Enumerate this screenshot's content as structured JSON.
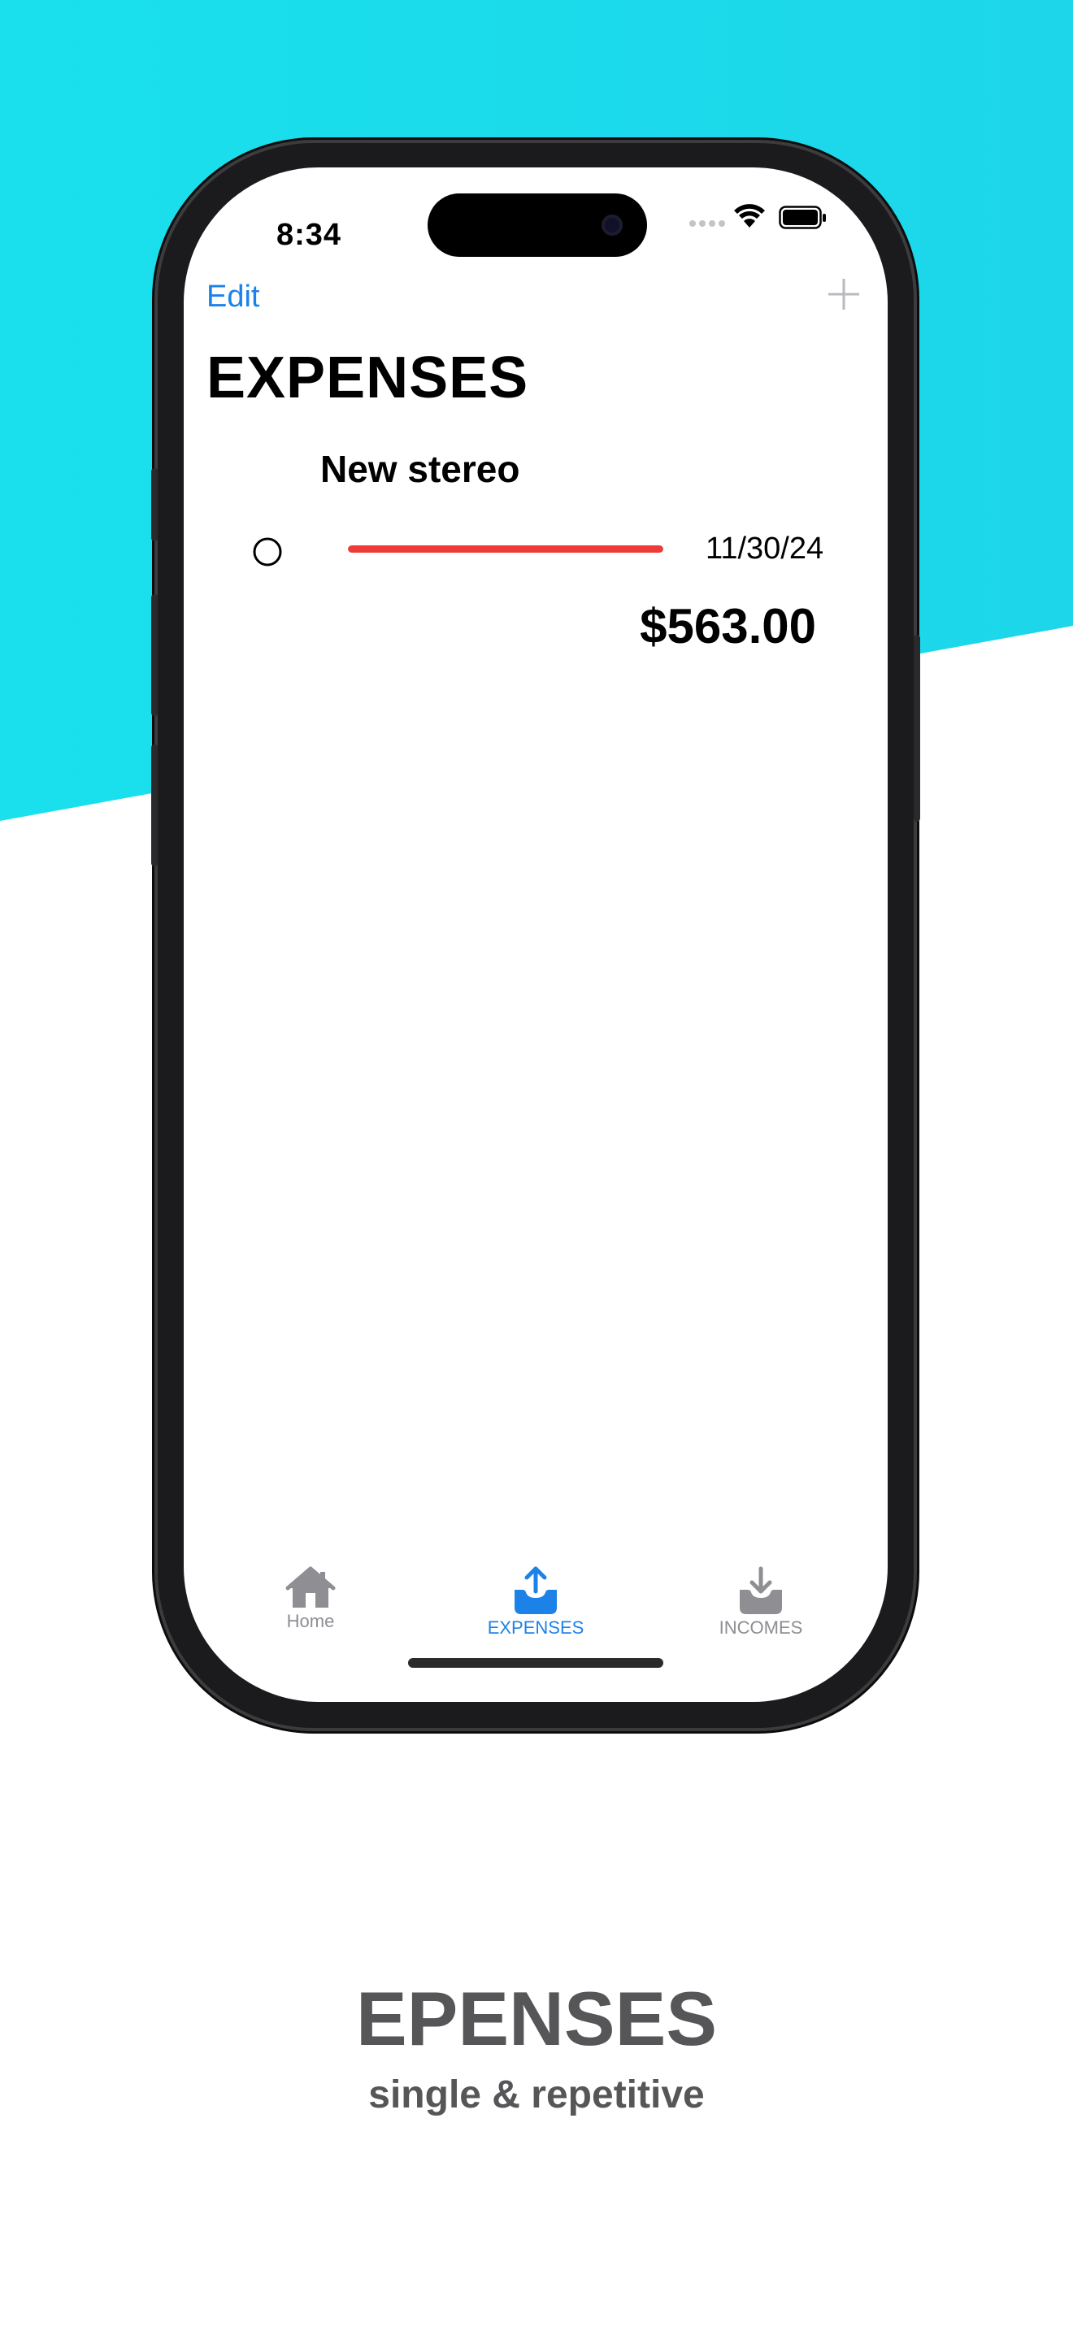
{
  "colors": {
    "background_accent": "#1cdbea",
    "link_blue": "#1d82e8",
    "progress_red": "#ee3b37",
    "tab_inactive": "#8e8e93",
    "caption_gray": "#565658"
  },
  "status_bar": {
    "time": "8:34",
    "icons": [
      "cellular-signal-icon",
      "wifi-icon",
      "battery-icon"
    ]
  },
  "nav": {
    "edit_label": "Edit",
    "add_icon": "plus-icon",
    "title": "EXPENSES"
  },
  "expenses": [
    {
      "name": "New stereo",
      "date": "11/30/24",
      "amount": "$563.00",
      "progress": 1.0,
      "status_icon": "circle-icon"
    }
  ],
  "tab_bar": {
    "tabs": [
      {
        "label": "Home",
        "icon": "house-icon",
        "active": false
      },
      {
        "label": "EXPENSES",
        "icon": "tray-upload-icon",
        "active": true
      },
      {
        "label": "INCOMES",
        "icon": "tray-download-icon",
        "active": false
      }
    ]
  },
  "caption": {
    "title": "EPENSES",
    "subtitle": "single & repetitive"
  }
}
